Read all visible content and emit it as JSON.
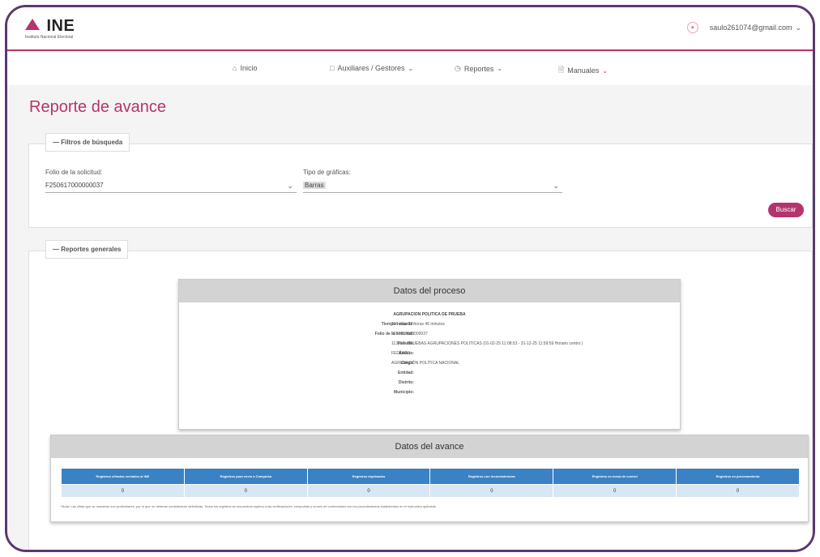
{
  "header": {
    "logo_text": "INE",
    "logo_sub": "Instituto Nacional Electoral",
    "user_email": "saulo261074@gmail.com",
    "user_chevron": "chevron-down-icon"
  },
  "nav": {
    "items": [
      {
        "label": "Inicio",
        "icon": "home-icon"
      },
      {
        "label": "Auxiliares / Gestores",
        "icon": "document-icon"
      },
      {
        "label": "Reportes",
        "icon": "clock-icon"
      },
      {
        "label": "Manuales",
        "icon": "file-icon"
      }
    ]
  },
  "page": {
    "title": "Reporte de avance"
  },
  "filters": {
    "legend": "—  Filtros de búsqueda",
    "folio_label": "Folio de la solicitud:",
    "folio_value": "F250617000000037",
    "tipo_label": "Tipo de gráficas:",
    "tipo_value": "Barras",
    "search_button": "Buscar"
  },
  "reports": {
    "legend": "—  Reportes generales"
  },
  "proceso": {
    "title": "Datos del proceso",
    "org": "AGRUPACION POLITICA DE PRUEBA",
    "rows": [
      {
        "k": "Tiempo restante:",
        "v": "316 días  22 horas  46 minutos"
      },
      {
        "k": "Folio de la solicitud:",
        "v": "F250617000000037"
      },
      {
        "k": "Periodo:",
        "v": "113216- PRUEBAS AGRUPACIONES POLITICAS (01-02-25 11:08:53 - 31-12-25 11:59:59 Horario centro )"
      },
      {
        "k": "Ámbito:",
        "v": "FEDERAL"
      },
      {
        "k": "Cargo:",
        "v": "AGRUPACIÓN POLÍTICA NACIONAL"
      },
      {
        "k": "Entidad:",
        "v": ""
      },
      {
        "k": "Distrito:",
        "v": ""
      },
      {
        "k": "Municipio:",
        "v": ""
      }
    ]
  },
  "avance": {
    "title": "Datos del avance",
    "headers": [
      "Registros cifrados enviados al INE",
      "Registros para envío a Compulsa",
      "Registros duplicados",
      "Registros con inconsistencias",
      "Registros en mesa de control",
      "Registros en procesamiento"
    ],
    "values": [
      "0",
      "0",
      "0",
      "0",
      "0",
      "0"
    ],
    "note": "*Nota: Las cifras que se muestran son preliminares, por lo que no deberán considerarse definitivas. Todos los registros se encuentran sujetos a las verificaciones, compulsas y cruces de conformidad con los procedimientos establecidos en el instructivo aplicable."
  }
}
